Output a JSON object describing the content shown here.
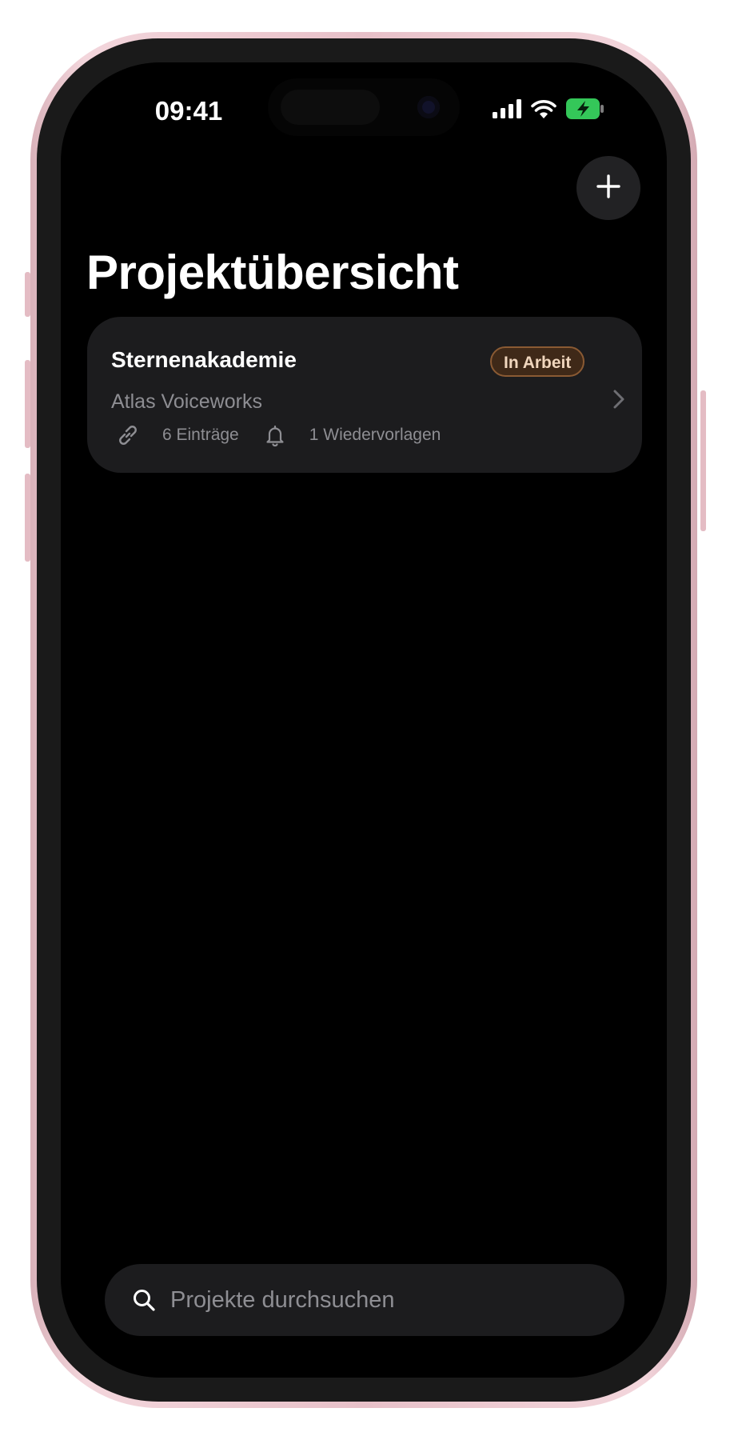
{
  "status_bar": {
    "time": "09:41",
    "icons": [
      "cellular-signal-icon",
      "wifi-icon",
      "battery-charging-icon"
    ],
    "battery_color": "#34c759"
  },
  "header": {
    "add_button_icon": "plus-icon",
    "title": "Projektübersicht"
  },
  "projects": [
    {
      "title": "Sternenakademie",
      "status": "In Arbeit",
      "status_color": "#8a5a33",
      "client": "Atlas Voiceworks",
      "entries": "6 Einträge",
      "reminders": "1 Wiedervorlagen"
    }
  ],
  "search": {
    "placeholder": "Projekte durchsuchen"
  },
  "theme": {
    "background": "#000000",
    "card": "#1c1c1e",
    "secondary_text": "#8e8e93",
    "frame": "#f0cfd6"
  }
}
